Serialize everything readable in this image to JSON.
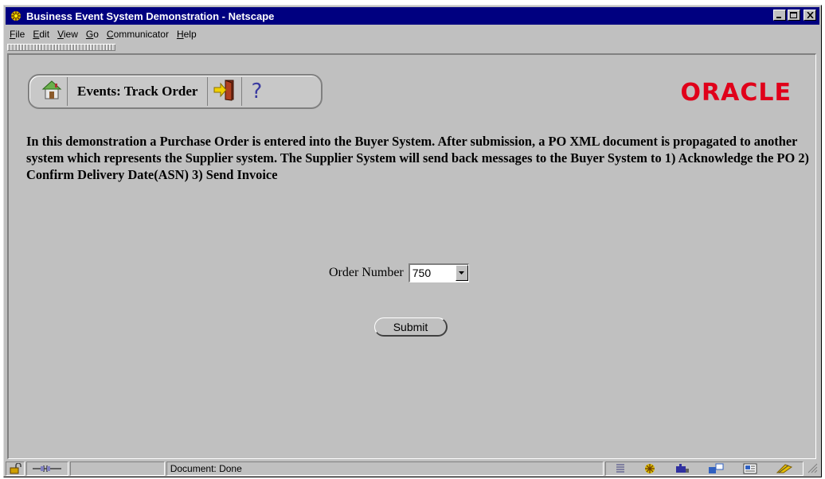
{
  "window": {
    "title": "Business Event System Demonstration - Netscape",
    "app_icon": "netscape-icon",
    "controls": [
      "minimize",
      "maximize",
      "close"
    ]
  },
  "menu": [
    {
      "label": "File",
      "accel": "F"
    },
    {
      "label": "Edit",
      "accel": "E"
    },
    {
      "label": "View",
      "accel": "V"
    },
    {
      "label": "Go",
      "accel": "G"
    },
    {
      "label": "Communicator",
      "accel": "C"
    },
    {
      "label": "Help",
      "accel": "H"
    }
  ],
  "nav": {
    "title": "Events: Track Order",
    "home_icon": "home-icon",
    "exit_icon": "exit-door-icon",
    "help_glyph": "?"
  },
  "brand": {
    "logo_text": "ORACLE",
    "color": "#e0001a"
  },
  "description": "In this demonstration a Purchase Order is entered into the Buyer System. After submission, a PO XML document is propagated to another system which represents the Supplier system. The Supplier System will send back messages to the Buyer System to 1) Acknowledge the PO 2) Confirm Delivery Date(ASN) 3) Send Invoice",
  "form": {
    "order_label": "Order Number",
    "order_value": "750",
    "submit_label": "Submit"
  },
  "status": {
    "text": "Document: Done"
  }
}
